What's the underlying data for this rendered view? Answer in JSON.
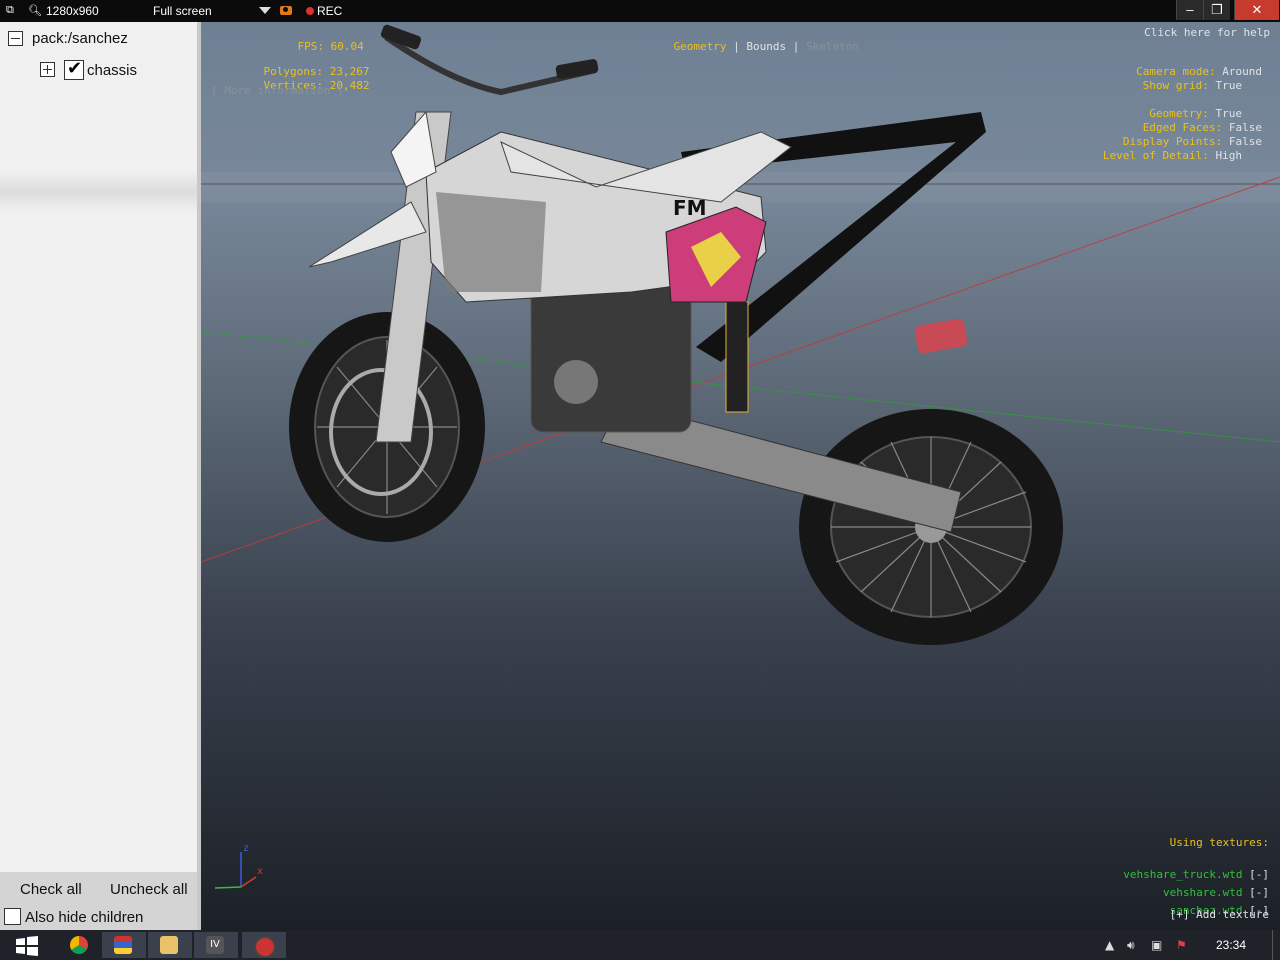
{
  "recorder": {
    "resolution": "1280x960",
    "mode": "Full screen",
    "rec_label": "REC"
  },
  "sidebar": {
    "root_label": "pack:/sanchez",
    "child_label": "chassis",
    "child_checked": true,
    "check_all": "Check all",
    "uncheck_all": "Uncheck all",
    "hide_children": "Also hide children"
  },
  "viewport": {
    "fps_label": "FPS:",
    "fps_value": "60.04",
    "polygons_label": "Polygons:",
    "polygons_value": "23,267",
    "vertices_label": "Vertices:",
    "vertices_value": "20,482",
    "more_info": "[ More information ]",
    "tabs": [
      "Geometry",
      "Bounds",
      "Skeleton"
    ],
    "help": "Click here for help",
    "camera_mode_label": "Camera mode:",
    "camera_mode_value": "Around",
    "show_grid_label": "Show grid:",
    "show_grid_value": "True",
    "geometry_label": "Geometry:",
    "geometry_value": "True",
    "edged_faces_label": "Edged Faces:",
    "edged_faces_value": "False",
    "display_points_label": "Display Points:",
    "display_points_value": "False",
    "lod_label": "Level of Detail:",
    "lod_value": "High",
    "textures_title": "Using textures:",
    "textures": [
      "vehshare_truck.wtd",
      "vehshare.wtd",
      "sanchez.wtd"
    ],
    "remove_label": "[-]",
    "add_texture": "[+] Add texture",
    "decal_text": "FM",
    "axis_x": "x",
    "axis_z": "z"
  },
  "taskbar": {
    "apps": [
      "start-icon",
      "chrome-icon",
      "archive-icon",
      "explorer-icon",
      "iv-icon",
      "viewer-icon"
    ],
    "iv_label": "IV",
    "clock": "23:34"
  },
  "colors": {
    "hud_yellow": "#e9c01f",
    "hud_white": "#dfe3e6",
    "hud_green": "#2fc13e",
    "close_red": "#c73b2f"
  }
}
